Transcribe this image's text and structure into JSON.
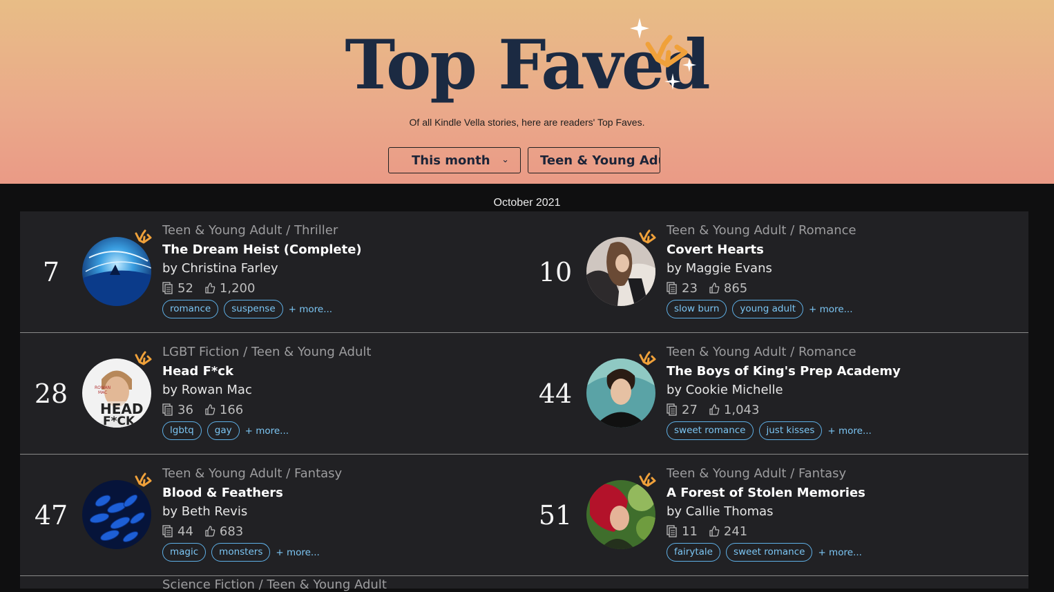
{
  "header": {
    "title": "Top Faved",
    "subtitle": "Of all Kindle Vella stories, here are readers' Top Faves.",
    "filters": [
      {
        "label": "This month",
        "icon": "chevron-down-icon"
      },
      {
        "label": "Teen & Young Adult"
      }
    ]
  },
  "period": "October 2021",
  "colors": {
    "accent_link": "#7cc6f4",
    "crown": "#f0a13a",
    "title_navy": "#1b2a42"
  },
  "stories": [
    {
      "rank": "7",
      "genre": "Teen & Young Adult / Thriller",
      "title": "The Dream Heist (Complete)",
      "author": "by Christina Farley",
      "episodes": "52",
      "faves": "1,200",
      "tags": [
        "romance",
        "suspense"
      ],
      "more": "+ more..."
    },
    {
      "rank": "10",
      "genre": "Teen & Young Adult / Romance",
      "title": "Covert Hearts",
      "author": "by Maggie Evans",
      "episodes": "23",
      "faves": "865",
      "tags": [
        "slow burn",
        "young adult"
      ],
      "more": "+ more..."
    },
    {
      "rank": "28",
      "genre": "LGBT Fiction / Teen & Young Adult",
      "title": "Head F*ck",
      "author": "by Rowan Mac",
      "episodes": "36",
      "faves": "166",
      "tags": [
        "lgbtq",
        "gay"
      ],
      "more": "+ more..."
    },
    {
      "rank": "44",
      "genre": "Teen & Young Adult / Romance",
      "title": "The Boys of King's Prep Academy",
      "author": "by Cookie Michelle",
      "episodes": "27",
      "faves": "1,043",
      "tags": [
        "sweet romance",
        "just kisses"
      ],
      "more": "+ more..."
    },
    {
      "rank": "47",
      "genre": "Teen & Young Adult / Fantasy",
      "title": "Blood & Feathers",
      "author": "by Beth Revis",
      "episodes": "44",
      "faves": "683",
      "tags": [
        "magic",
        "monsters"
      ],
      "more": "+ more..."
    },
    {
      "rank": "51",
      "genre": "Teen & Young Adult / Fantasy",
      "title": "A Forest of Stolen Memories",
      "author": "by Callie Thomas",
      "episodes": "11",
      "faves": "241",
      "tags": [
        "fairytale",
        "sweet romance"
      ],
      "more": "+ more..."
    }
  ],
  "next_row_genre": "Science Fiction / Teen & Young Adult",
  "cover_art": {
    "rowan_mac_small": "ROWAN",
    "rowan_mac_small2": "MAC",
    "head_word": "HEAD",
    "fck_word": "F*CK"
  }
}
